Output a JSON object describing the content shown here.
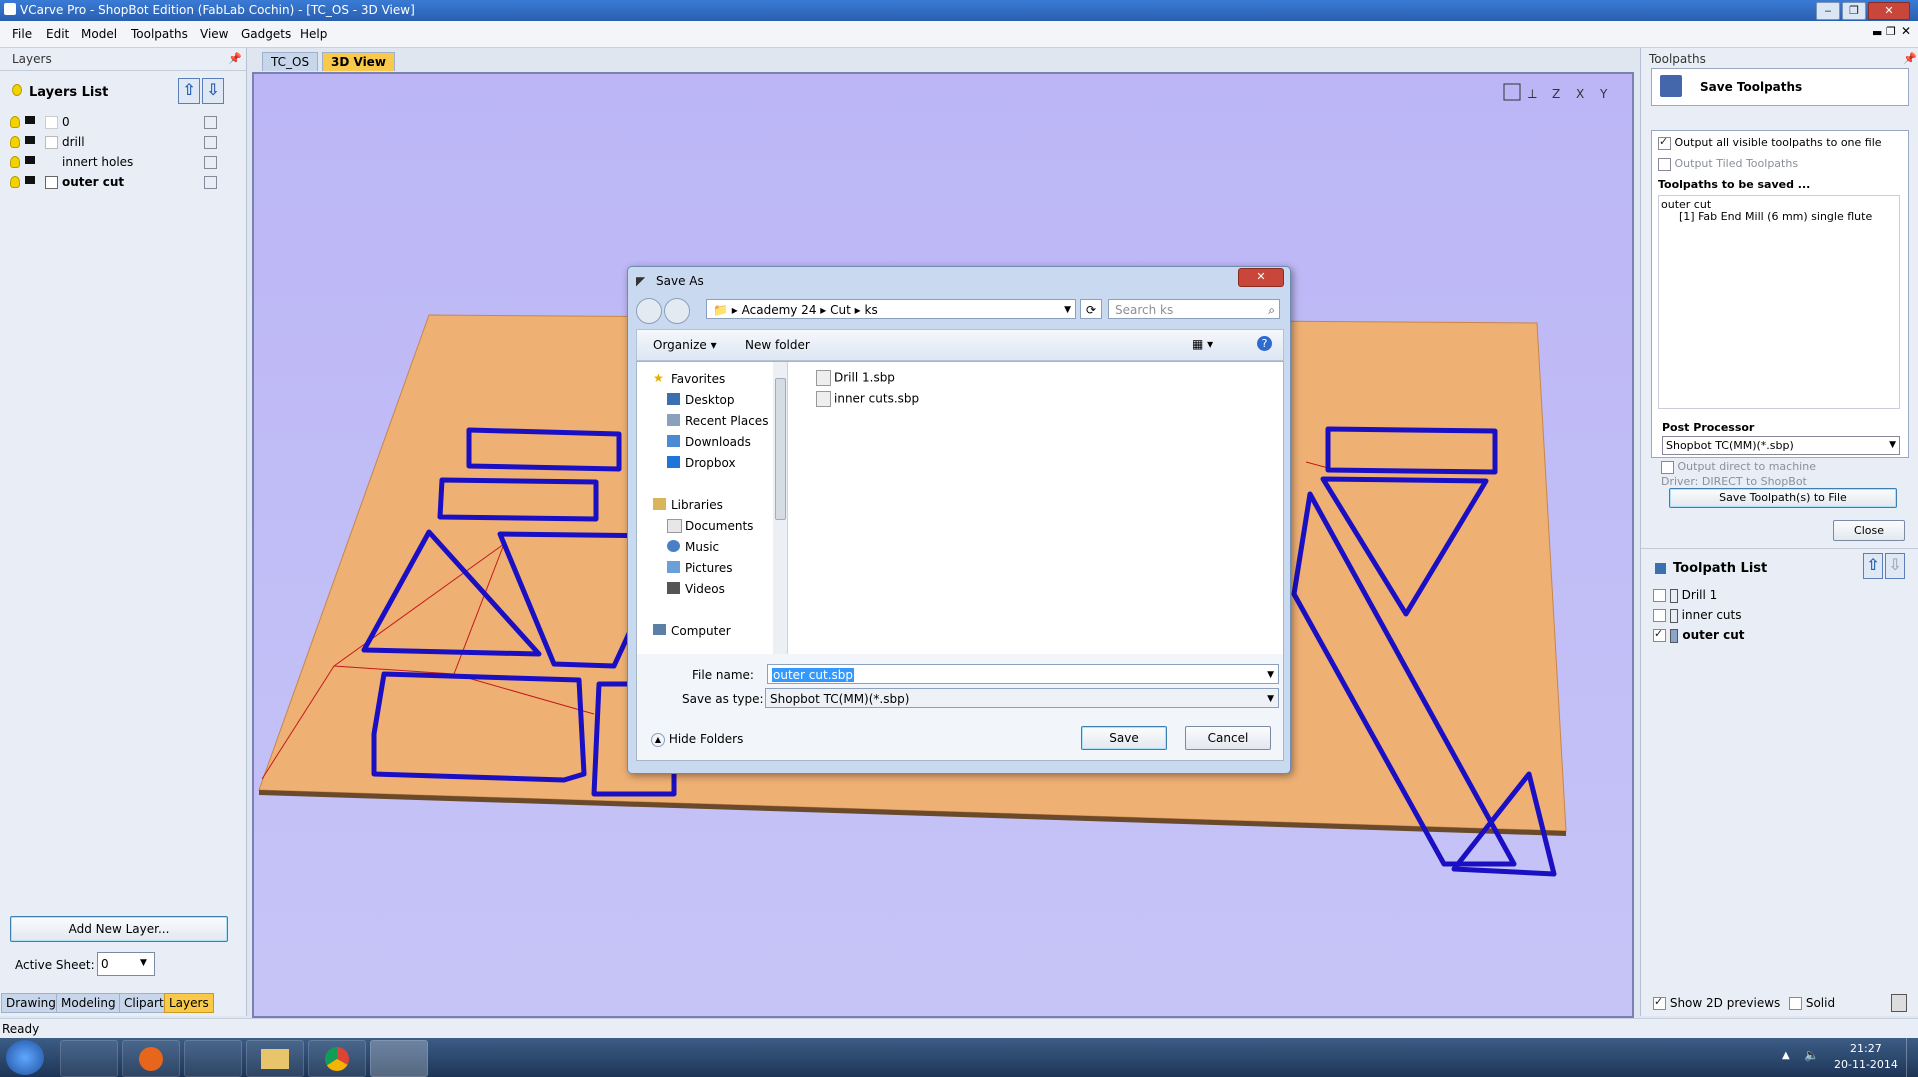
{
  "window": {
    "title": "VCarve Pro - ShopBot Edition (FabLab Cochin) - [TC_OS - 3D View]"
  },
  "menu": [
    "File",
    "Edit",
    "Model",
    "Toolpaths",
    "View",
    "Gadgets",
    "Help"
  ],
  "left": {
    "panel_title": "Layers",
    "layers_list_title": "Layers List",
    "layers": [
      {
        "name": "0",
        "bold": false
      },
      {
        "name": "drill",
        "bold": false
      },
      {
        "name": "innert holes",
        "bold": false
      },
      {
        "name": "outer cut",
        "bold": true
      }
    ],
    "add_layer": "Add New Layer...",
    "active_sheet_label": "Active Sheet:",
    "active_sheet_value": "0",
    "tabs": [
      "Drawing",
      "Modeling",
      "Clipart",
      "Layers"
    ]
  },
  "view_tabs": [
    "TC_OS",
    "3D View"
  ],
  "right": {
    "panel_title": "Toolpaths",
    "save_title": "Save Toolpaths",
    "output_all": "Output all visible toolpaths to one file",
    "output_tiled": "Output Tiled Toolpaths",
    "to_be_saved": "Toolpaths to be saved ...",
    "saved_list": [
      "outer cut",
      "[1] Fab End Mill (6 mm) single flute"
    ],
    "post_processor_label": "Post Processor",
    "post_processor_value": "Shopbot TC(MM)(*.sbp)",
    "output_direct": "Output direct to machine",
    "driver": "Driver: DIRECT to ShopBot",
    "save_button": "Save Toolpath(s) to File",
    "close_button": "Close",
    "toolpath_list_title": "Toolpath List",
    "toolpaths": [
      {
        "name": "Drill 1",
        "checked": false,
        "bold": false
      },
      {
        "name": "inner cuts",
        "checked": false,
        "bold": false
      },
      {
        "name": "outer cut",
        "checked": true,
        "bold": true
      }
    ],
    "show_2d": "Show 2D previews",
    "solid": "Solid"
  },
  "dialog": {
    "title": "Save As",
    "breadcrumb": [
      "Academy 24",
      "Cut",
      "ks"
    ],
    "search_placeholder": "Search ks",
    "organize": "Organize",
    "new_folder": "New folder",
    "nav": {
      "favorites": "Favorites",
      "fav_items": [
        "Desktop",
        "Recent Places",
        "Downloads",
        "Dropbox"
      ],
      "libraries": "Libraries",
      "lib_items": [
        "Documents",
        "Music",
        "Pictures",
        "Videos"
      ],
      "computer": "Computer"
    },
    "files": [
      "Drill 1.sbp",
      "inner cuts.sbp"
    ],
    "file_name_label": "File name:",
    "file_name_value": "outer cut.sbp",
    "save_type_label": "Save as type:",
    "save_type_value": "Shopbot TC(MM)(*.sbp)",
    "hide_folders": "Hide Folders",
    "save": "Save",
    "cancel": "Cancel"
  },
  "status": {
    "text": "Ready"
  },
  "taskbar": {
    "time": "21:27",
    "date": "20-11-2014"
  }
}
